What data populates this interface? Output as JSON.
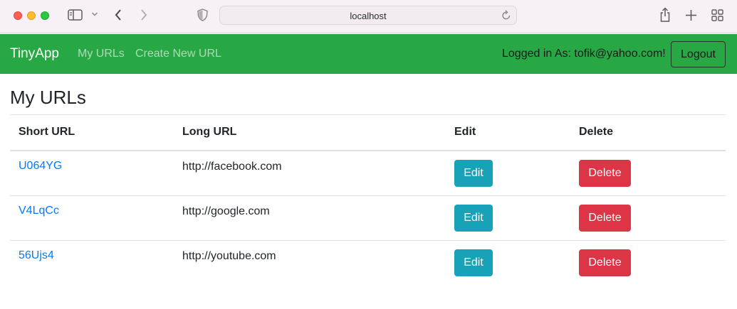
{
  "browser": {
    "address": "localhost"
  },
  "navbar": {
    "brand": "TinyApp",
    "links": [
      {
        "label": "My URLs"
      },
      {
        "label": "Create New URL"
      }
    ],
    "logged_in": "Logged in As: tofik@yahoo.com!",
    "logout_label": "Logout",
    "color": "#28a745"
  },
  "main": {
    "title": "My URLs",
    "columns": [
      "Short URL",
      "Long URL",
      "Edit",
      "Delete"
    ],
    "rows": [
      {
        "short": "U064YG",
        "long": "http://facebook.com",
        "edit": "Edit",
        "delete": "Delete"
      },
      {
        "short": "V4LqCc",
        "long": "http://google.com",
        "edit": "Edit",
        "delete": "Delete"
      },
      {
        "short": "56Ujs4",
        "long": "http://youtube.com",
        "edit": "Edit",
        "delete": "Delete"
      }
    ]
  },
  "colors": {
    "link": "#007bff",
    "edit_button": "#17a2b8",
    "delete_button": "#dc3545"
  },
  "icons": [
    "sidebar-toggle-icon",
    "chevron-down-icon",
    "back-icon",
    "forward-icon",
    "shield-icon",
    "reload-icon",
    "share-icon",
    "plus-icon",
    "tab-overview-icon"
  ]
}
